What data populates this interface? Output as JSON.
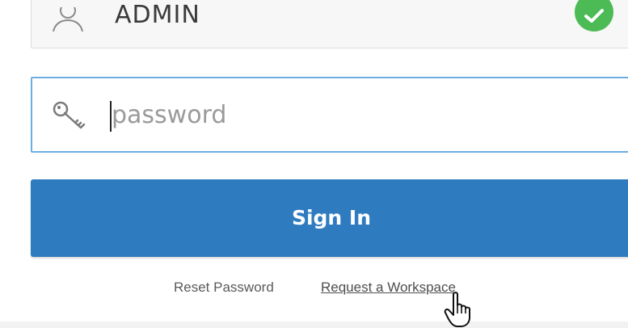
{
  "login": {
    "username_value": "ADMIN",
    "password_placeholder": "password",
    "password_value": "",
    "signin_label": "Sign In",
    "reset_password_label": "Reset Password",
    "request_workspace_label": "Request a Workspace"
  },
  "icons": {
    "user": "user-icon",
    "key": "key-icon",
    "check": "check-icon",
    "cursor": "hand-pointer-cursor-icon"
  },
  "colors": {
    "primary_button": "#2f7bbf",
    "focus_border": "#6aaee3",
    "valid_badge": "#4cbb55"
  }
}
